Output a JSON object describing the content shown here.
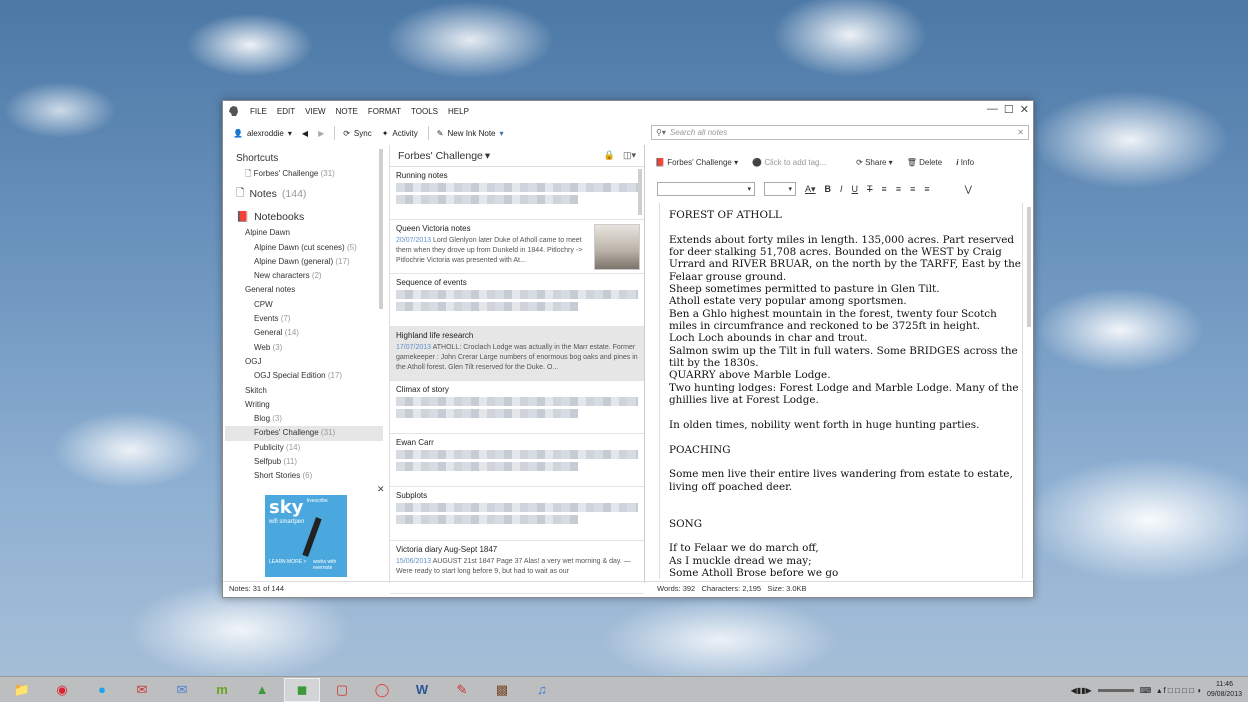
{
  "menubar": {
    "items": [
      "FILE",
      "EDIT",
      "VIEW",
      "NOTE",
      "FORMAT",
      "TOOLS",
      "HELP"
    ]
  },
  "toolbar": {
    "user": "alexroddie",
    "sync": "Sync",
    "activity": "Activity",
    "new_ink_note": "New Ink Note"
  },
  "search": {
    "placeholder": "Search all notes"
  },
  "sidebar": {
    "shortcuts": "Shortcuts",
    "shortcut_item": "Forbes' Challenge",
    "shortcut_count": "(31)",
    "notes_label": "Notes",
    "notes_count": "(144)",
    "notebooks": "Notebooks",
    "items": [
      {
        "label": "Alpine Dawn",
        "count": "",
        "level": 1
      },
      {
        "label": "Alpine Dawn (cut scenes)",
        "count": "(5)",
        "level": 2
      },
      {
        "label": "Alpine Dawn (general)",
        "count": "(17)",
        "level": 2
      },
      {
        "label": "New characters",
        "count": "(2)",
        "level": 2
      },
      {
        "label": "General notes",
        "count": "",
        "level": 1
      },
      {
        "label": "CPW",
        "count": "",
        "level": 2
      },
      {
        "label": "Events",
        "count": "(7)",
        "level": 2
      },
      {
        "label": "General",
        "count": "(14)",
        "level": 2
      },
      {
        "label": "Web",
        "count": "(3)",
        "level": 2
      },
      {
        "label": "OGJ",
        "count": "",
        "level": 1
      },
      {
        "label": "OGJ Special Edition",
        "count": "(17)",
        "level": 2
      },
      {
        "label": "Skitch",
        "count": "",
        "level": 1
      },
      {
        "label": "Writing",
        "count": "",
        "level": 1
      },
      {
        "label": "Blog",
        "count": "(3)",
        "level": 2
      },
      {
        "label": "Forbes' Challenge",
        "count": "(31)",
        "level": 2,
        "selected": true
      },
      {
        "label": "Publicity",
        "count": "(14)",
        "level": 2
      },
      {
        "label": "Selfpub",
        "count": "(11)",
        "level": 2
      },
      {
        "label": "Short Stories",
        "count": "(6)",
        "level": 2
      }
    ]
  },
  "ad": {
    "brand": "livescribe",
    "sky": "sky",
    "wifi": "wifi smartpen",
    "learn": "LEARN MORE >",
    "works": "works with evernote"
  },
  "notelist": {
    "title": "Forbes' Challenge",
    "notes": [
      {
        "title": "Running notes",
        "date": "",
        "snippet": "",
        "blurred": true
      },
      {
        "title": "Queen Victoria notes",
        "date": "20/07/2013",
        "snippet": "Lord Glenlyon later Duke of Atholl came to meet them when they drove up from Dunkeld in 1844. Pitlochry -> Pitlochrie Victoria was presented with At...",
        "blurred": false,
        "thumb": true
      },
      {
        "title": "Sequence of events",
        "date": "",
        "snippet": "",
        "blurred": true
      },
      {
        "title": "Highland life research",
        "date": "17/07/2013",
        "snippet": "ATHOLL: Croclach Lodge was actually in the Marr estate. Former gamekeeper : John Crerar Large numbers of enormous bog oaks and pines in the Atholl forest. Glen Tilt reserved for the Duke. O...",
        "blurred": false,
        "selected": true
      },
      {
        "title": "Climax of story",
        "date": "",
        "snippet": "",
        "blurred": true
      },
      {
        "title": "Ewan Carr",
        "date": "",
        "snippet": "",
        "blurred": true
      },
      {
        "title": "Subplots",
        "date": "",
        "snippet": "",
        "blurred": true
      },
      {
        "title": "Victoria diary Aug-Sept 1847",
        "date": "15/06/2013",
        "snippet": "AUGUST 21st 1847 Page 37 Alas! a very wet morning & day. — Were ready to start long before 9, but had to wait as our",
        "blurred": false
      }
    ]
  },
  "editor": {
    "notebook": "Forbes' Challenge",
    "tag_placeholder": "Click to add tag...",
    "share": "Share",
    "delete": "Delete",
    "info": "Info",
    "paragraphs": [
      "FOREST OF ATHOLL",
      "",
      "Extends about forty miles in length. 135,000 acres. Part reserved for deer stalking 51,708 acres. Bounded on the WEST by Craig Urrard and RIVER BRUAR, on the north by the TARFF, East by the Felaar grouse ground.",
      "Sheep sometimes permitted to pasture in Glen Tilt.",
      "Atholl estate very popular among sportsmen.",
      "Ben a Ghlo highest mountain in the forest, twenty four Scotch miles in circumfrance and reckoned to be 3725ft in height.",
      "Loch Loch abounds in char and trout.",
      "Salmon swim up the Tilt in full waters. Some BRIDGES across the tilt by the 1830s.",
      "QUARRY above Marble Lodge.",
      "Two hunting lodges: Forest Lodge and Marble Lodge. Many of the ghillies live at Forest Lodge.",
      "",
      "In olden times, nobility went forth in huge hunting parties.",
      "",
      "POACHING",
      "",
      "Some men live their entire lives wandering from estate to estate, living off poached deer.",
      "",
      "",
      "SONG",
      "",
      "If to Felaar we do march off,",
      "As I muckle dread we may;",
      "Some Atholl Brose before we go"
    ]
  },
  "status": {
    "notes": "Notes: 31 of 144",
    "words": "Words: 392",
    "characters": "Characters: 2,195",
    "size": "Size: 3.0KB"
  },
  "taskbar": {
    "time": "11:46",
    "date": "09/08/2013"
  }
}
